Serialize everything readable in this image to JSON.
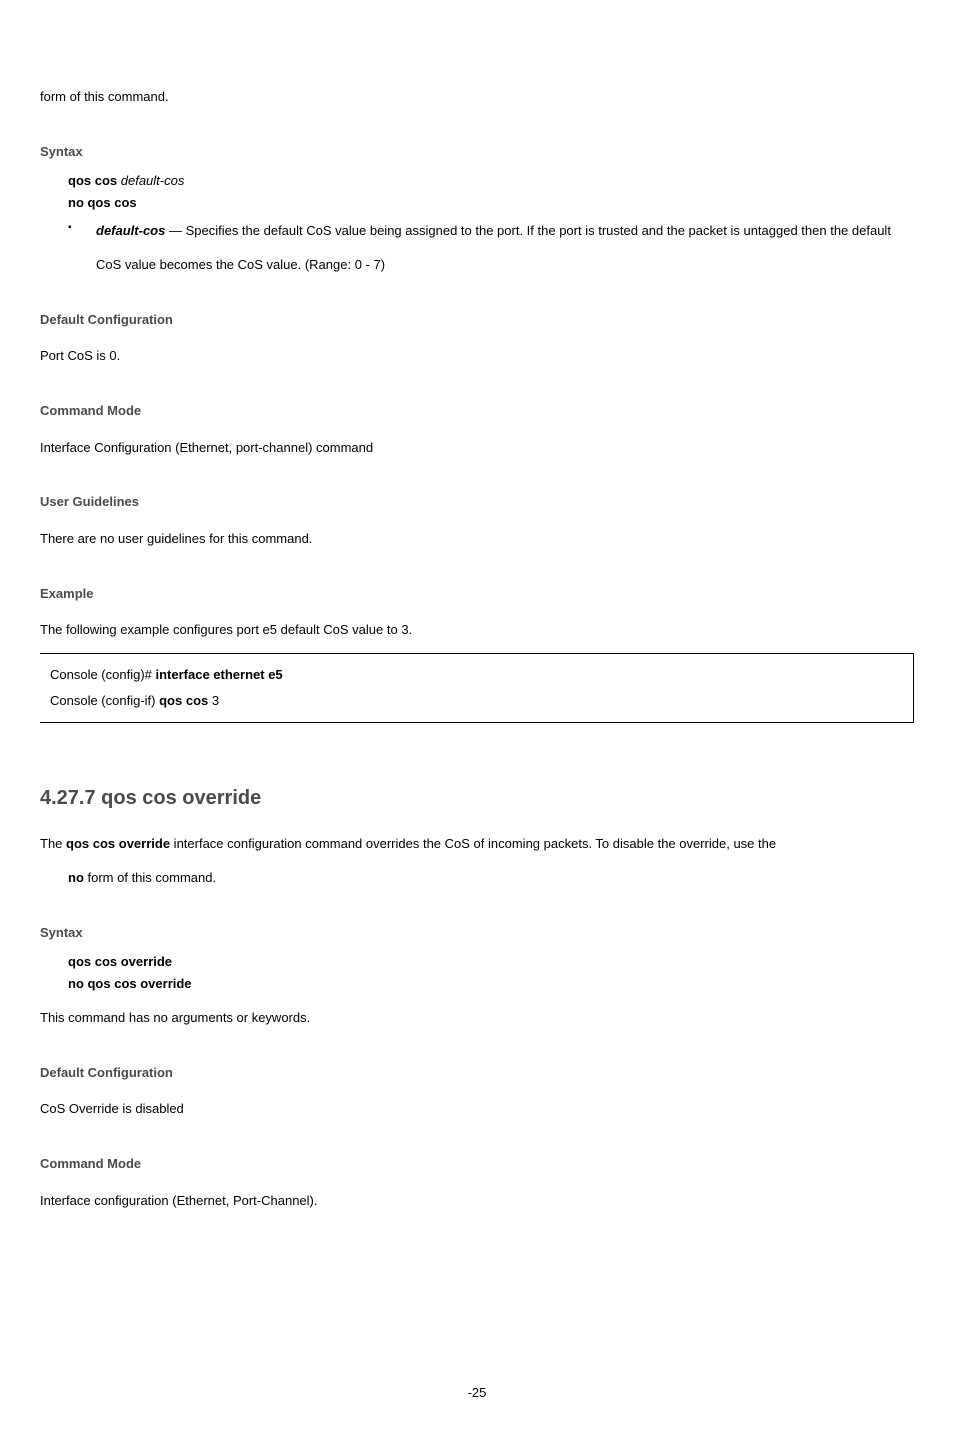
{
  "intro_trail": "form of this command.",
  "sec1": {
    "syntax_heading": "Syntax",
    "syntax_line1_bold": "qos cos",
    "syntax_line1_ital": "default-cos",
    "syntax_line2": "no qos cos",
    "bullet_param_ital": "default-cos",
    "bullet_text_after": " — Specifies the default CoS value being assigned to the port. If the port is trusted and the packet is untagged then the default CoS value becomes the CoS value. (Range: 0 - 7)",
    "default_heading": "Default Configuration",
    "default_text": "Port CoS is 0.",
    "mode_heading": "Command Mode",
    "mode_text": "Interface Configuration (Ethernet, port-channel) command",
    "guide_heading": "User Guidelines",
    "guide_text": "There are no user guidelines for this command.",
    "ex_heading": "Example",
    "ex_text": "The following example configures port e5 default CoS value to 3.",
    "code": {
      "l1_a": "Console (config)# ",
      "l1_b": "interface ethernet e5",
      "l2_a": "Console (config-if) ",
      "l2_b": "qos cos ",
      "l2_c": "3"
    }
  },
  "sec2": {
    "cmd_title": "4.27.7 qos cos override",
    "desc_pre": "The ",
    "desc_bold": "qos cos override",
    "desc_post": " interface configuration command overrides the CoS of incoming packets. To disable the override, use the ",
    "desc_no_bold": "no",
    "desc_tail": " form of this command.",
    "syntax_heading": "Syntax",
    "syntax_line1": "qos cos override",
    "syntax_line2": "no qos cos override",
    "noargs": "This command has no arguments or keywords.",
    "default_heading": "Default Configuration",
    "default_text": "CoS Override is disabled",
    "mode_heading": "Command Mode",
    "mode_text": "Interface configuration (Ethernet, Port-Channel)."
  },
  "page_number": "-25"
}
